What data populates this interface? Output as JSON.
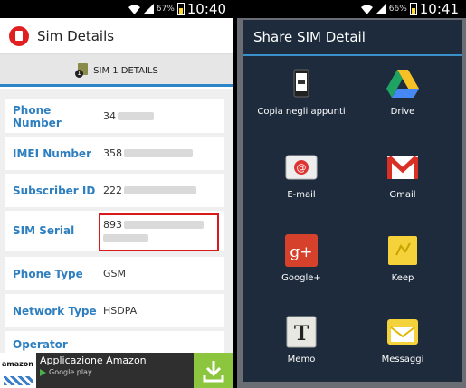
{
  "left": {
    "status": {
      "battery": "67%",
      "time": "10:40"
    },
    "app_title": "Sim Details",
    "tab_label": "SIM 1 DETAILS",
    "sim_badge": "1",
    "rows": [
      {
        "label": "Phone Number",
        "value": "34"
      },
      {
        "label": "IMEI Number",
        "value": "358"
      },
      {
        "label": "Subscriber ID",
        "value": "222"
      },
      {
        "label": "SIM Serial",
        "value": "893"
      },
      {
        "label": "Phone Type",
        "value": "GSM"
      },
      {
        "label": "Network Type",
        "value": "HSDPA"
      },
      {
        "label": "Operator",
        "value": ""
      }
    ],
    "ad": {
      "logo": "amazon",
      "text": "Applicazione Amazon",
      "store": "Google play"
    }
  },
  "right": {
    "status": {
      "battery": "66%",
      "time": "10:41"
    },
    "dialog_title": "Share SIM Detail",
    "items": [
      {
        "label": "Copia negli appunti",
        "icon": "clipboard-icon"
      },
      {
        "label": "Drive",
        "icon": "drive-icon"
      },
      {
        "label": "E-mail",
        "icon": "email-icon"
      },
      {
        "label": "Gmail",
        "icon": "gmail-icon"
      },
      {
        "label": "Google+",
        "icon": "google-plus-icon"
      },
      {
        "label": "Keep",
        "icon": "keep-icon"
      },
      {
        "label": "Memo",
        "icon": "memo-icon"
      },
      {
        "label": "Messaggi",
        "icon": "messages-icon"
      }
    ]
  },
  "colors": {
    "accent_blue": "#2e7fc0",
    "highlight_red": "#d81a1a",
    "dialog_bg": "#1d2b3c"
  }
}
